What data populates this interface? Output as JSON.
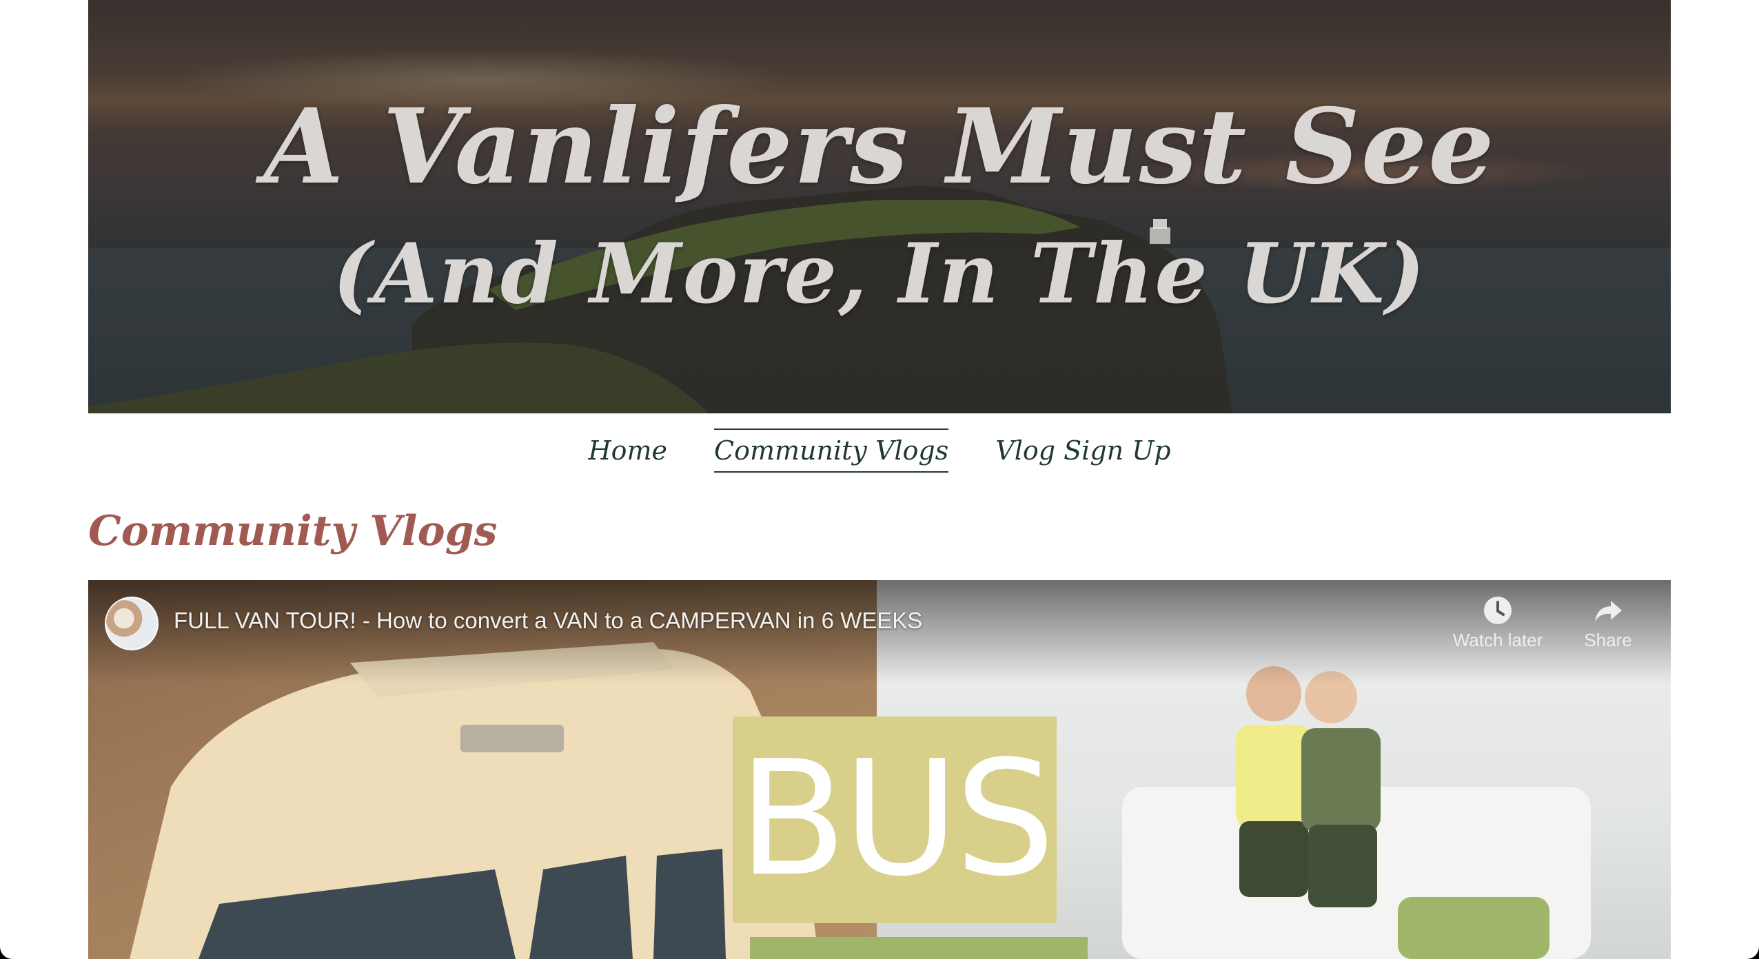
{
  "hero": {
    "title_line1": "A Vanlifers Must See",
    "title_line2": "(And More, In The UK)"
  },
  "nav": {
    "items": [
      {
        "label": "Home",
        "active": false
      },
      {
        "label": "Community Vlogs",
        "active": true
      },
      {
        "label": "Vlog Sign Up",
        "active": false
      }
    ]
  },
  "page": {
    "heading": "Community Vlogs"
  },
  "video": {
    "title": "FULL VAN TOUR! - How to convert a VAN to a CAMPERVAN in 6 WEEKS",
    "thumbnail_text": "BUS",
    "watch_later_label": "Watch later",
    "share_label": "Share",
    "icons": {
      "watch_later": "clock-icon",
      "share": "share-arrow-icon"
    }
  },
  "colors": {
    "nav_text": "#1f3a2c",
    "heading": "#a05a52",
    "hero_text": "#d9d6d4"
  }
}
